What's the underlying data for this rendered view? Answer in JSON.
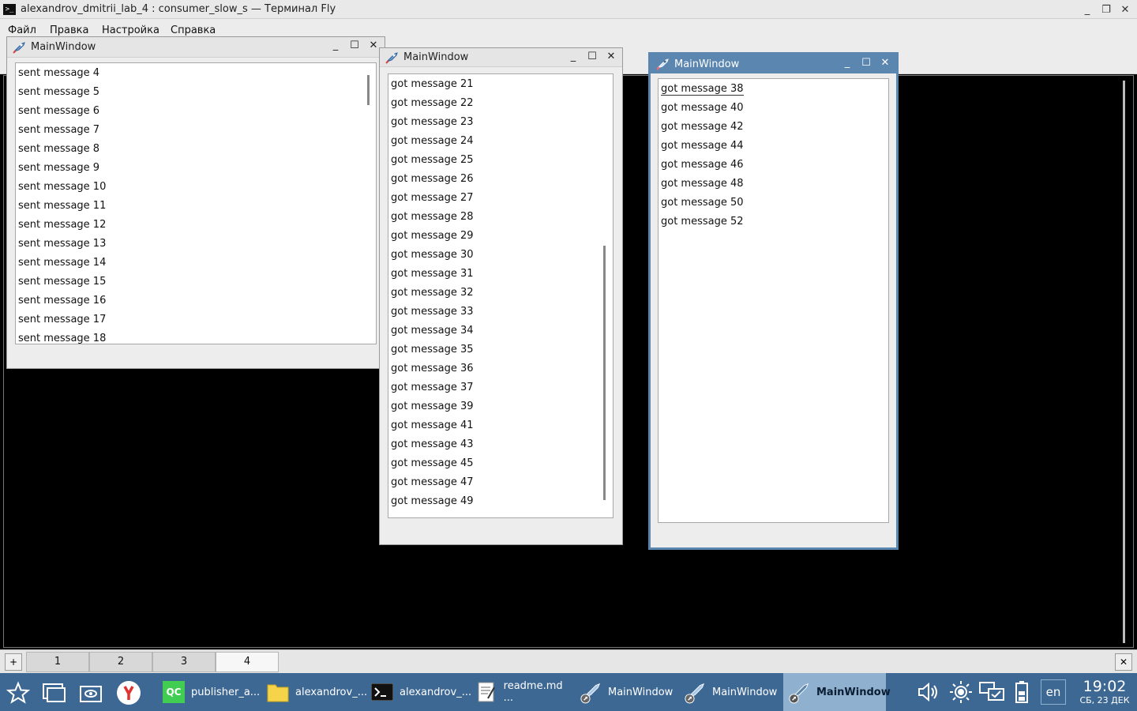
{
  "terminal": {
    "title": "alexandrov_dmitrii_lab_4 : consumer_slow_s — Терминал Fly",
    "menu": [
      "Файл",
      "Правка",
      "Настройка",
      "Справка"
    ],
    "tabs": [
      "1",
      "2",
      "3",
      "4"
    ],
    "active_tab": "4"
  },
  "window1": {
    "title": "MainWindow",
    "items": [
      "sent message 4",
      "sent message 5",
      "sent message 6",
      "sent message 7",
      "sent message 8",
      "sent message 9",
      "sent message 10",
      "sent message 11",
      "sent message 12",
      "sent message 13",
      "sent message 14",
      "sent message 15",
      "sent message 16",
      "sent message 17",
      "sent message 18"
    ]
  },
  "window2": {
    "title": "MainWindow",
    "items": [
      "got message 21",
      "got message 22",
      "got message 23",
      "got message 24",
      "got message 25",
      "got message 26",
      "got message 27",
      "got message 28",
      "got message 29",
      "got message 30",
      "got message 31",
      "got message 32",
      "got message 33",
      "got message 34",
      "got message 35",
      "got message 36",
      "got message 37",
      "got message 39",
      "got message 41",
      "got message 43",
      "got message 45",
      "got message 47",
      "got message 49"
    ]
  },
  "window3": {
    "title": "MainWindow",
    "items": [
      "got message 38",
      "got message 40",
      "got message 42",
      "got message 44",
      "got message 46",
      "got message 48",
      "got message 50",
      "got message 52"
    ]
  },
  "taskbar": {
    "tasks": [
      {
        "label": "publisher_a...",
        "icon": "qtcreator-icon"
      },
      {
        "label": "alexandrov_...",
        "icon": "folder-icon"
      },
      {
        "label": "alexandrov_...",
        "icon": "terminal-icon"
      },
      {
        "label": "readme.md  ...",
        "icon": "text-editor-icon"
      },
      {
        "label": "MainWindow",
        "icon": "rocket-icon"
      },
      {
        "label": "MainWindow",
        "icon": "rocket-icon"
      },
      {
        "label": "MainWindow",
        "icon": "rocket-icon"
      }
    ],
    "lang": "en",
    "time": "19:02",
    "date": "СБ, 23 ДЕК",
    "qt_icon_text": "QC"
  },
  "colors": {
    "accent": "#3d6893",
    "active_title": "#5b86b0"
  }
}
